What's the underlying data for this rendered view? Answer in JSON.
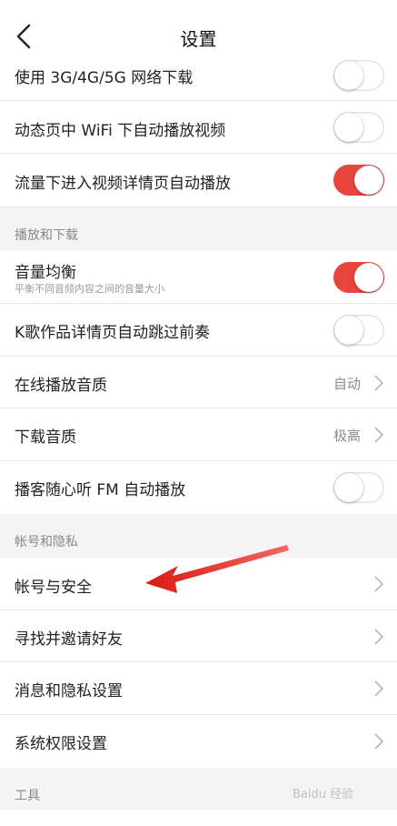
{
  "header": {
    "title": "设置",
    "back_icon": "chevron-left-icon"
  },
  "rows_top": [
    {
      "label": "使用 3G/4G/5G 网络下载",
      "toggle": "off"
    },
    {
      "label": "动态页中 WiFi 下自动播放视频",
      "toggle": "off"
    },
    {
      "label": "流量下进入视频详情页自动播放",
      "toggle": "on"
    }
  ],
  "section_playback": "播放和下载",
  "playback": [
    {
      "label": "音量均衡",
      "sub": "平衡不同音频内容之间的音量大小",
      "toggle": "on"
    },
    {
      "label": "K歌作品详情页自动跳过前奏",
      "toggle": "off"
    },
    {
      "label": "在线播放音质",
      "value": "自动"
    },
    {
      "label": "下载音质",
      "value": "极高"
    },
    {
      "label": "播客随心听 FM 自动播放",
      "toggle": "off"
    }
  ],
  "section_account": "帐号和隐私",
  "account": [
    {
      "label": "帐号与安全"
    },
    {
      "label": "寻找并邀请好友"
    },
    {
      "label": "消息和隐私设置"
    },
    {
      "label": "系统权限设置"
    }
  ],
  "section_tools": "工具",
  "colors": {
    "accent": "#e8453c",
    "annotation_arrow": "#e3241b"
  },
  "watermark": "Baidu 经验"
}
